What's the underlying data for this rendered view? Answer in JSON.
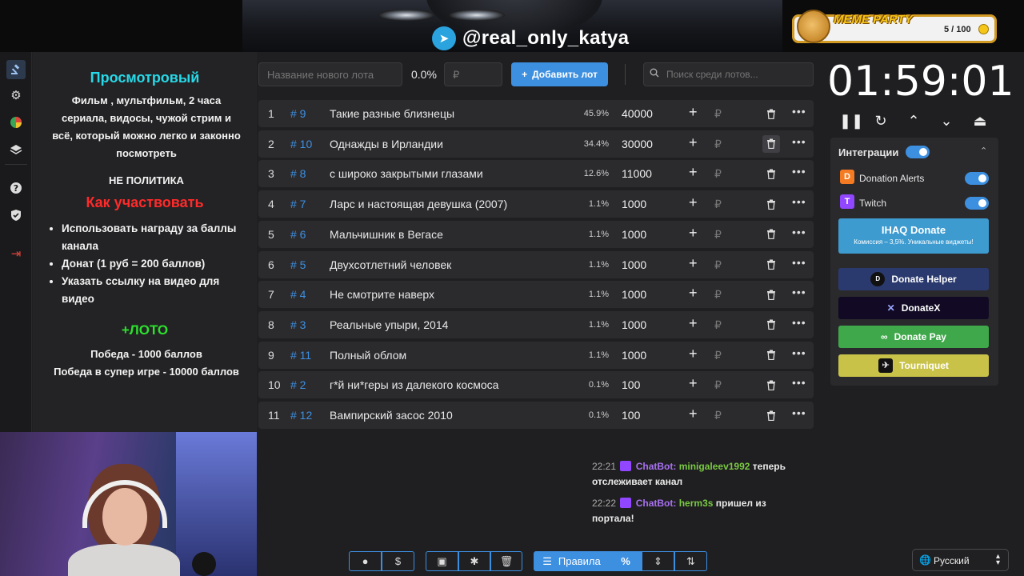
{
  "banner": {
    "handle": "@real_only_katya",
    "telegram_icon": "telegram-icon"
  },
  "meme_party": {
    "title": "MEME PARTY",
    "count": "5 / 100"
  },
  "rail": [
    "auction-icon",
    "gear-icon",
    "pie-chart-icon",
    "layers-icon",
    "help-icon",
    "shield-icon",
    "logout-icon"
  ],
  "rules": {
    "title": "Просмотровый",
    "desc": "Фильм , мультфильм, 2 часа сериала, видосы, чужой стрим и всё, который можно легко и законно посмотреть",
    "not_politics": "НЕ ПОЛИТИКА",
    "how_title": "Как участвовать",
    "items": [
      "Использовать награду за баллы канала",
      "Донат (1 руб = 200 баллов)",
      "Указать ссылку на видео для видео"
    ],
    "lotto_title": "+ЛОТО",
    "lotto_win": "Победа - 1000 баллов",
    "lotto_super": "Победа в супер игре - 10000 баллов"
  },
  "toolbar": {
    "lot_placeholder": "Название нового лота",
    "percent": "0.0%",
    "amount_placeholder": "₽",
    "add_label": "Добавить лот",
    "search_placeholder": "Поиск среди лотов..."
  },
  "lots": [
    {
      "n": "1",
      "id": "# 9",
      "title": "Такие разные близнецы",
      "pct": "45.9%",
      "amount": "40000"
    },
    {
      "n": "2",
      "id": "# 10",
      "title": "Однажды в Ирландии",
      "pct": "34.4%",
      "amount": "30000"
    },
    {
      "n": "3",
      "id": "# 8",
      "title": "с широко закрытыми глазами",
      "pct": "12.6%",
      "amount": "11000"
    },
    {
      "n": "4",
      "id": "# 7",
      "title": "Ларс и настоящая девушка (2007)",
      "pct": "1.1%",
      "amount": "1000"
    },
    {
      "n": "5",
      "id": "# 6",
      "title": "Мальчишник в Вегасе",
      "pct": "1.1%",
      "amount": "1000"
    },
    {
      "n": "6",
      "id": "# 5",
      "title": "Двухсотлетний человек",
      "pct": "1.1%",
      "amount": "1000"
    },
    {
      "n": "7",
      "id": "# 4",
      "title": "Не смотрите наверх",
      "pct": "1.1%",
      "amount": "1000"
    },
    {
      "n": "8",
      "id": "# 3",
      "title": "Реальные упыри, 2014",
      "pct": "1.1%",
      "amount": "1000"
    },
    {
      "n": "9",
      "id": "# 11",
      "title": "Полный облом",
      "pct": "1.1%",
      "amount": "1000"
    },
    {
      "n": "10",
      "id": "# 2",
      "title": "г*й ни*геры из далекого космоса",
      "pct": "0.1%",
      "amount": "100"
    },
    {
      "n": "11",
      "id": "# 12",
      "title": "Вампирский засос 2010",
      "pct": "0.1%",
      "amount": "100"
    }
  ],
  "row_currency": "₽",
  "chat": [
    {
      "time": "22:21",
      "bot": "ChatBot:",
      "user": "minigaleev1992",
      "text": " теперь отслеживает канал"
    },
    {
      "time": "22:22",
      "bot": "ChatBot:",
      "user": "herm3s",
      "text": " пришел из портала!"
    }
  ],
  "bottom": {
    "rules_label": "Правила",
    "percent_label": "%"
  },
  "language": "Русский",
  "timer": "01:59:01",
  "integrations": {
    "title": "Интеграции",
    "donation_alerts": "Donation Alerts",
    "twitch": "Twitch",
    "ihaq_title": "IHAQ Donate",
    "ihaq_sub": "Комиссия – 3,5%. Уникальные виджеты!",
    "donate_helper": "Donate Helper",
    "donatex": "DonateX",
    "donate_pay": "Donate Pay",
    "tourniquet": "Tourniquet"
  },
  "colors": {
    "accent": "#3d8fe0",
    "cyan": "#27d9e8",
    "red": "#ff2a2a",
    "green": "#2de02d",
    "bot": "#a871f0"
  }
}
